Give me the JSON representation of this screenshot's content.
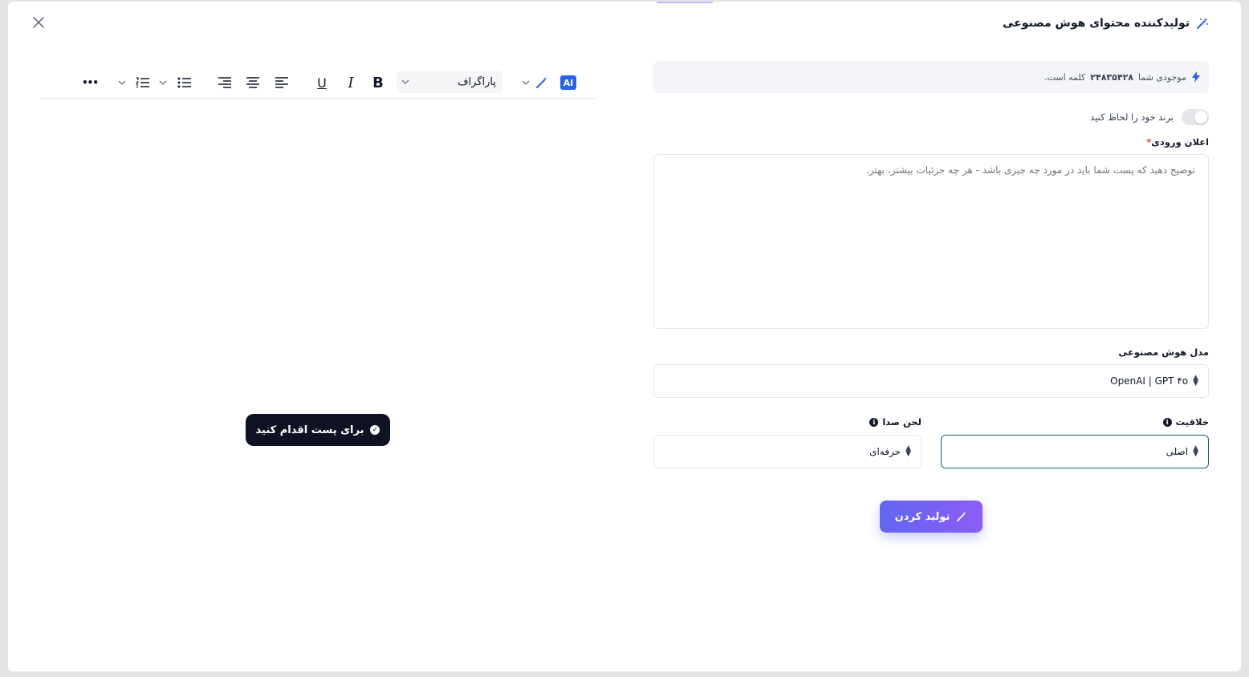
{
  "header": {
    "title": "تولیدکننده محتوای هوش مصنوعی",
    "icon": "magic-wand-icon"
  },
  "balance": {
    "prefix": "موجودی شما",
    "amount": "۲۴۸۳۵۴۲۸",
    "suffix": "کلمه است."
  },
  "brand_toggle": {
    "label": "برند خود را لحاظ کنید",
    "on": false
  },
  "prompt": {
    "label": "اعلان ورودی",
    "required_mark": "*",
    "placeholder": "توضیح دهید که پست شما باید در مورد چه چیزی باشد - هر چه جزئیات بیشتر، بهتر."
  },
  "model": {
    "label": "مدل هوش مصنوعی",
    "value": "OpenAI | GPT ۴o"
  },
  "creativity": {
    "label": "خلاقیت",
    "value": "اصلی"
  },
  "tone": {
    "label": "لحن صدا",
    "value": "حرفه‌ای"
  },
  "generate_button": {
    "label": "تولید کردن"
  },
  "editor": {
    "ai_badge": "AI",
    "paragraph_select": "پاراگراف",
    "more": "•••",
    "action_button": "برای پست اقدام کنید"
  },
  "colors": {
    "accent": "#6366f1",
    "accent_2": "#8b5cf6",
    "ai_blue": "#2563eb",
    "dark_button": "#0f1222",
    "required": "#ef4444"
  }
}
